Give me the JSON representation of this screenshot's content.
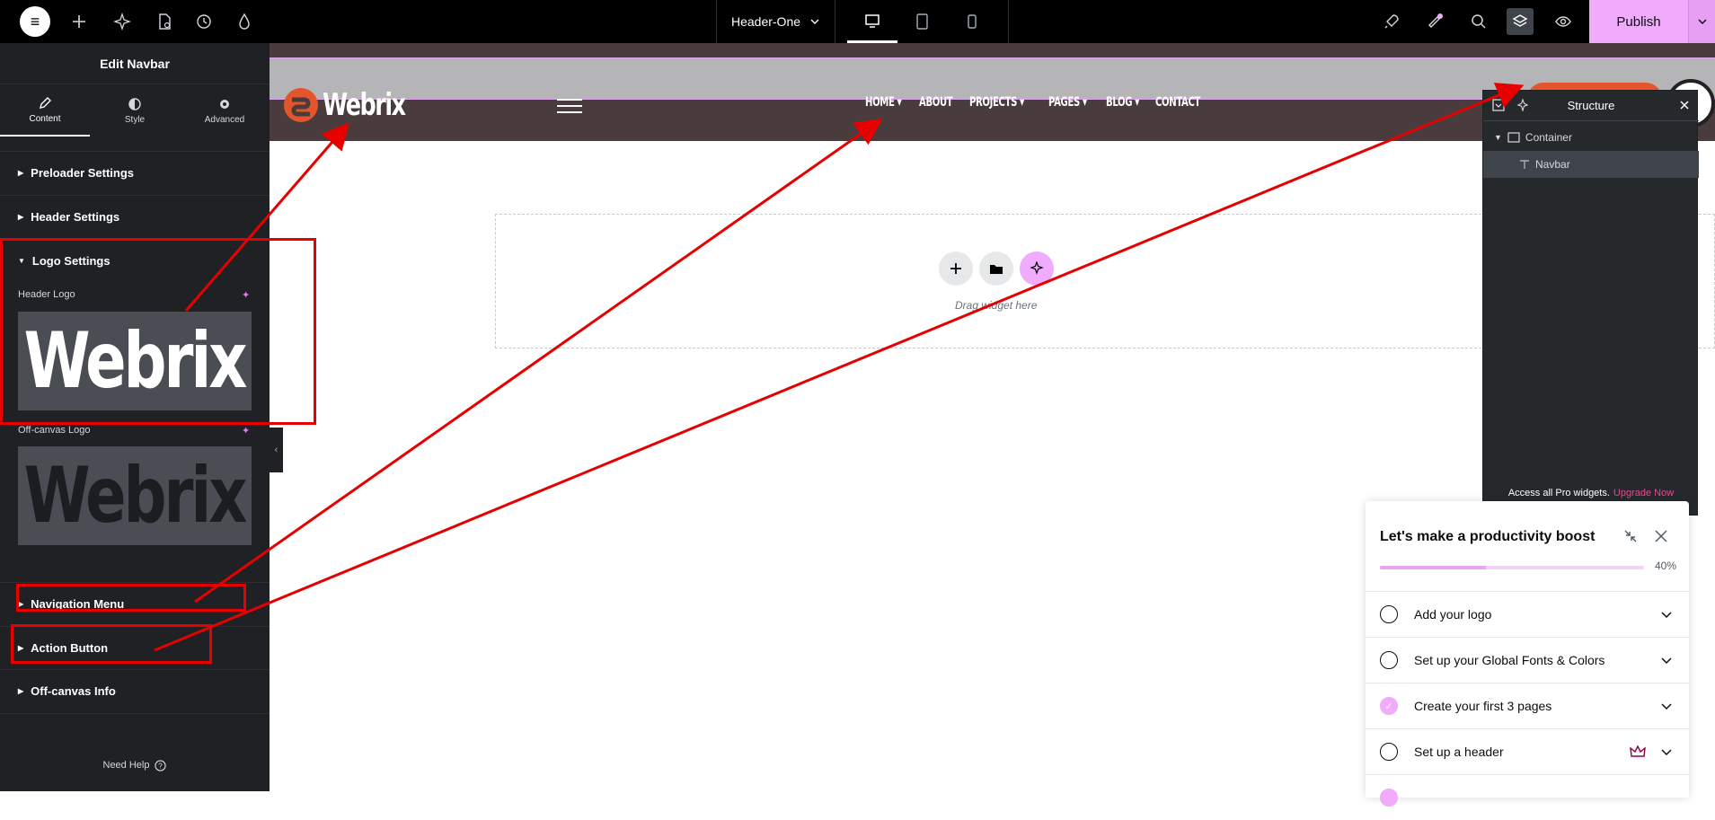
{
  "topbar": {
    "document_title": "Header-One",
    "publish_label": "Publish"
  },
  "panel": {
    "title": "Edit Navbar",
    "tabs": [
      {
        "label": "Content"
      },
      {
        "label": "Style"
      },
      {
        "label": "Advanced"
      }
    ],
    "sections": {
      "preloader": "Preloader Settings",
      "header": "Header Settings",
      "logo": "Logo Settings",
      "navigation": "Navigation Menu",
      "action": "Action Button",
      "offcanvas_info": "Off-canvas Info"
    },
    "fields": {
      "header_logo_label": "Header Logo",
      "offcanvas_logo_label": "Off-canvas Logo",
      "logo_image_text": "Webrix"
    },
    "need_help": "Need Help"
  },
  "site": {
    "logo_text": "Webrix",
    "nav": [
      "HOME",
      "ABOUT",
      "PROJECTS",
      "PAGES",
      "BLOG",
      "CONTACT"
    ]
  },
  "canvas": {
    "dropzone_text": "Drag widget here"
  },
  "structure": {
    "title": "Structure",
    "items": [
      {
        "label": "Container"
      },
      {
        "label": "Navbar"
      }
    ],
    "upsell_text": "Access all Pro widgets.",
    "upsell_link": "Upgrade Now"
  },
  "checklist": {
    "title": "Let's make a productivity boost",
    "progress_label": "40%",
    "progress_fraction": 0.4,
    "items": [
      {
        "label": "Add your logo",
        "done": false
      },
      {
        "label": "Set up your Global Fonts & Colors",
        "done": false
      },
      {
        "label": "Create your first 3 pages",
        "done": true
      },
      {
        "label": "Set up a header",
        "done": false
      }
    ]
  },
  "colors": {
    "accent": "#f0abfc",
    "annotation": "#e60000",
    "panel_bg": "#1f2124",
    "header_bg": "#4a3c3d"
  }
}
